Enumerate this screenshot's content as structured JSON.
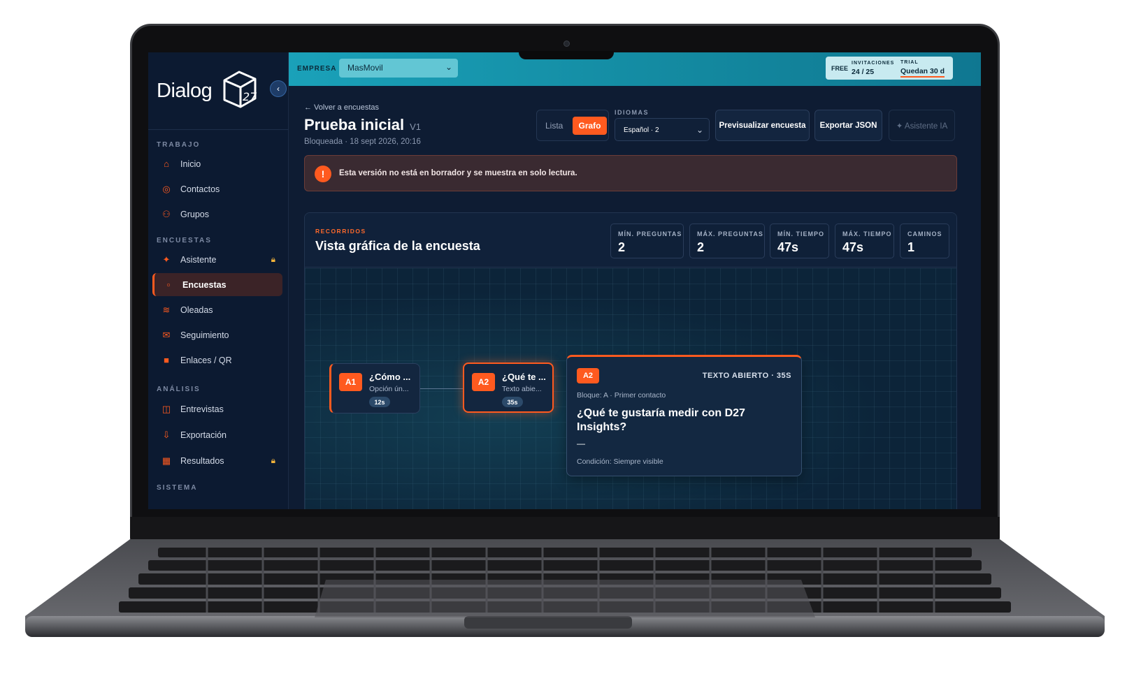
{
  "sidebar": {
    "brand": "Dialog",
    "brand_mark": "27",
    "sections": {
      "trabajo": "TRABAJO",
      "encuestas": "ENCUESTAS",
      "analisis": "ANÁLISIS",
      "sistema": "SISTEMA"
    },
    "items": [
      {
        "label": "Inicio",
        "icon": "home-icon"
      },
      {
        "label": "Contactos",
        "icon": "target-icon"
      },
      {
        "label": "Grupos",
        "icon": "users-icon"
      },
      {
        "label": "Asistente",
        "icon": "sparkle-icon",
        "locked": true
      },
      {
        "label": "Encuestas",
        "icon": "square-icon",
        "active": true
      },
      {
        "label": "Oleadas",
        "icon": "waves-icon"
      },
      {
        "label": "Seguimiento",
        "icon": "mail-icon"
      },
      {
        "label": "Enlaces / QR",
        "icon": "qr-icon"
      },
      {
        "label": "Entrevistas",
        "icon": "columns-icon"
      },
      {
        "label": "Exportación",
        "icon": "download-icon"
      },
      {
        "label": "Resultados",
        "icon": "chart-icon",
        "locked": true
      }
    ]
  },
  "topbar": {
    "company_label": "EMPRESA",
    "company_value": "MasMovil",
    "plan": "FREE",
    "invites_label": "INVITACIONES",
    "invites_value": "24  /  25",
    "trial_label": "TRIAL",
    "trial_value": "Quedan 30 d"
  },
  "header": {
    "back": "← Volver a encuestas",
    "title": "Prueba inicial",
    "version": "V1",
    "subtitle": "Bloqueada · 18 sept 2026, 20:16",
    "view_list": "Lista",
    "view_graph": "Grafo",
    "languages_label": "IDIOMAS",
    "language_value": "Español · 2",
    "preview_btn": "Previsualizar encuesta",
    "export_btn": "Exportar JSON",
    "ai_btn": "✦ Asistente IA"
  },
  "alert": {
    "icon": "!",
    "text": "Esta versión no está en borrador y se muestra en solo lectura."
  },
  "panel": {
    "kicker": "RECORRIDOS",
    "title": "Vista gráfica de la encuesta",
    "stats": [
      {
        "label": "MÍN. PREGUNTAS",
        "value": "2"
      },
      {
        "label": "MÁX. PREGUNTAS",
        "value": "2"
      },
      {
        "label": "MÍN. TIEMPO",
        "value": "47s"
      },
      {
        "label": "MÁX. TIEMPO",
        "value": "47s"
      },
      {
        "label": "CAMINOS",
        "value": "1"
      }
    ]
  },
  "graph": {
    "nodes": [
      {
        "id": "A1",
        "question": "¿Cómo ...",
        "type": "Opción ún...",
        "time": "12s"
      },
      {
        "id": "A2",
        "question": "¿Qué te ...",
        "type": "Texto abie...",
        "time": "35s",
        "selected": true
      }
    ],
    "detail": {
      "id": "A2",
      "kind": "TEXTO ABIERTO · 35S",
      "block": "Bloque: A · Primer contacto",
      "question": "¿Qué te gustaría medir con D27 Insights?",
      "dash": "—",
      "condition": "Condición: Siempre visible"
    }
  },
  "colors": {
    "accent": "#ff5a1f",
    "topbar": "#1aa1b9",
    "background": "#0e1c33"
  }
}
